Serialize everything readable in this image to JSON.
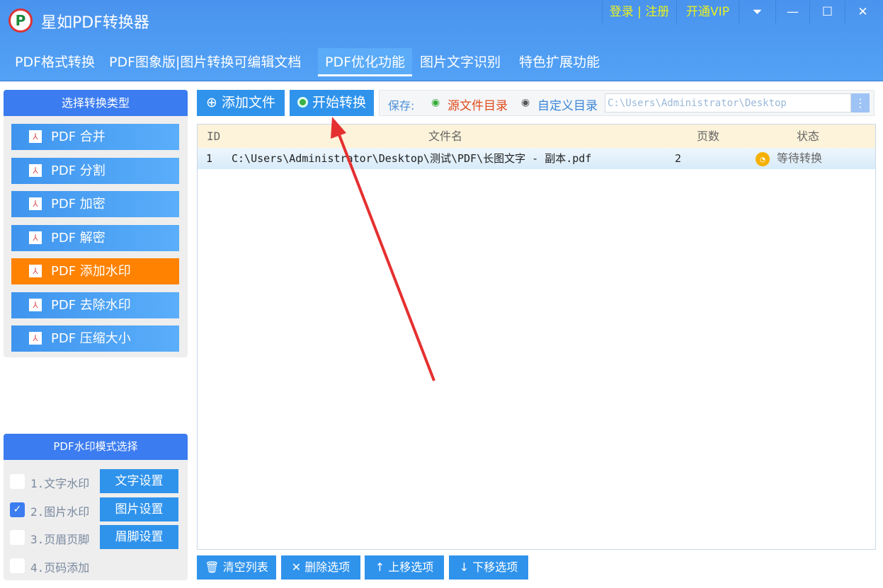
{
  "app": {
    "title": "星如PDF转换器",
    "logo_letter": "P"
  },
  "titlebar": {
    "login": "登录 | 注册",
    "vip": "开通VIP",
    "menu": "⏷",
    "min": "—",
    "max": "☐",
    "close": "✕"
  },
  "tabs": [
    "PDF格式转换",
    "PDF图象版|图片转换可编辑文档",
    "PDF优化功能",
    "图片文字识别",
    "特色扩展功能"
  ],
  "sidebar": {
    "title": "选择转换类型",
    "items": [
      "PDF 合并",
      "PDF 分割",
      "PDF 加密",
      "PDF 解密",
      "PDF 添加水印",
      "PDF 去除水印",
      "PDF 压缩大小"
    ]
  },
  "watermark": {
    "title": "PDF水印模式选择",
    "options": [
      {
        "label": "1.文字水印",
        "checked": false,
        "button": "文字设置"
      },
      {
        "label": "2.图片水印",
        "checked": true,
        "button": "图片设置"
      },
      {
        "label": "3.页眉页脚",
        "checked": false,
        "button": "眉脚设置"
      },
      {
        "label": "4.页码添加",
        "checked": false
      }
    ]
  },
  "toolbar": {
    "add": "添加文件",
    "start": "开始转换",
    "save_label": "保存:",
    "opt_source": "源文件目录",
    "opt_custom": "自定义目录",
    "path": "C:\\Users\\Administrator\\Desktop",
    "more": "⋮"
  },
  "table": {
    "headers": [
      "ID",
      "文件名",
      "页数",
      "状态"
    ],
    "rows": [
      {
        "id": "1",
        "file": "C:\\Users\\Administrator\\Desktop\\测试\\PDF\\长图文字 - 副本.pdf",
        "pages": "2",
        "status": "等待转换"
      }
    ]
  },
  "bottom": {
    "clear": "清空列表",
    "delete": "删除选项",
    "up": "上移选项",
    "down": "下移选项"
  },
  "colors": {
    "accent": "#2f93ec",
    "active": "#ff8200",
    "arrow": "#e53030"
  }
}
